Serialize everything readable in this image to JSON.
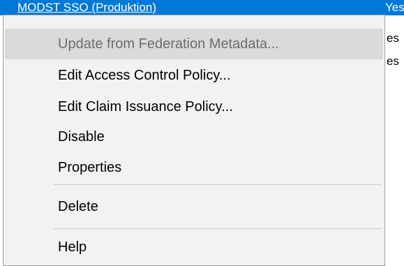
{
  "list": {
    "rows": [
      {
        "name": "MODST SSO (Produktion)",
        "value": "Yes",
        "selected": true
      },
      {
        "name": "",
        "value": "es",
        "selected": false
      },
      {
        "name": "",
        "value": "es",
        "selected": false
      }
    ]
  },
  "context_menu": {
    "items": [
      {
        "label": "Update from Federation Metadata...",
        "enabled": false
      },
      {
        "label": "Edit Access Control Policy...",
        "enabled": true
      },
      {
        "label": "Edit Claim Issuance Policy...",
        "enabled": true
      },
      {
        "label": "Disable",
        "enabled": true
      },
      {
        "label": "Properties",
        "enabled": true
      },
      {
        "label": "Delete",
        "enabled": true
      },
      {
        "label": "Help",
        "enabled": true
      }
    ]
  },
  "colors": {
    "selection": "#0078d7",
    "menu_background": "#f2f2f2",
    "menu_hover": "#dadada",
    "disabled_text": "#6d6d6d"
  }
}
